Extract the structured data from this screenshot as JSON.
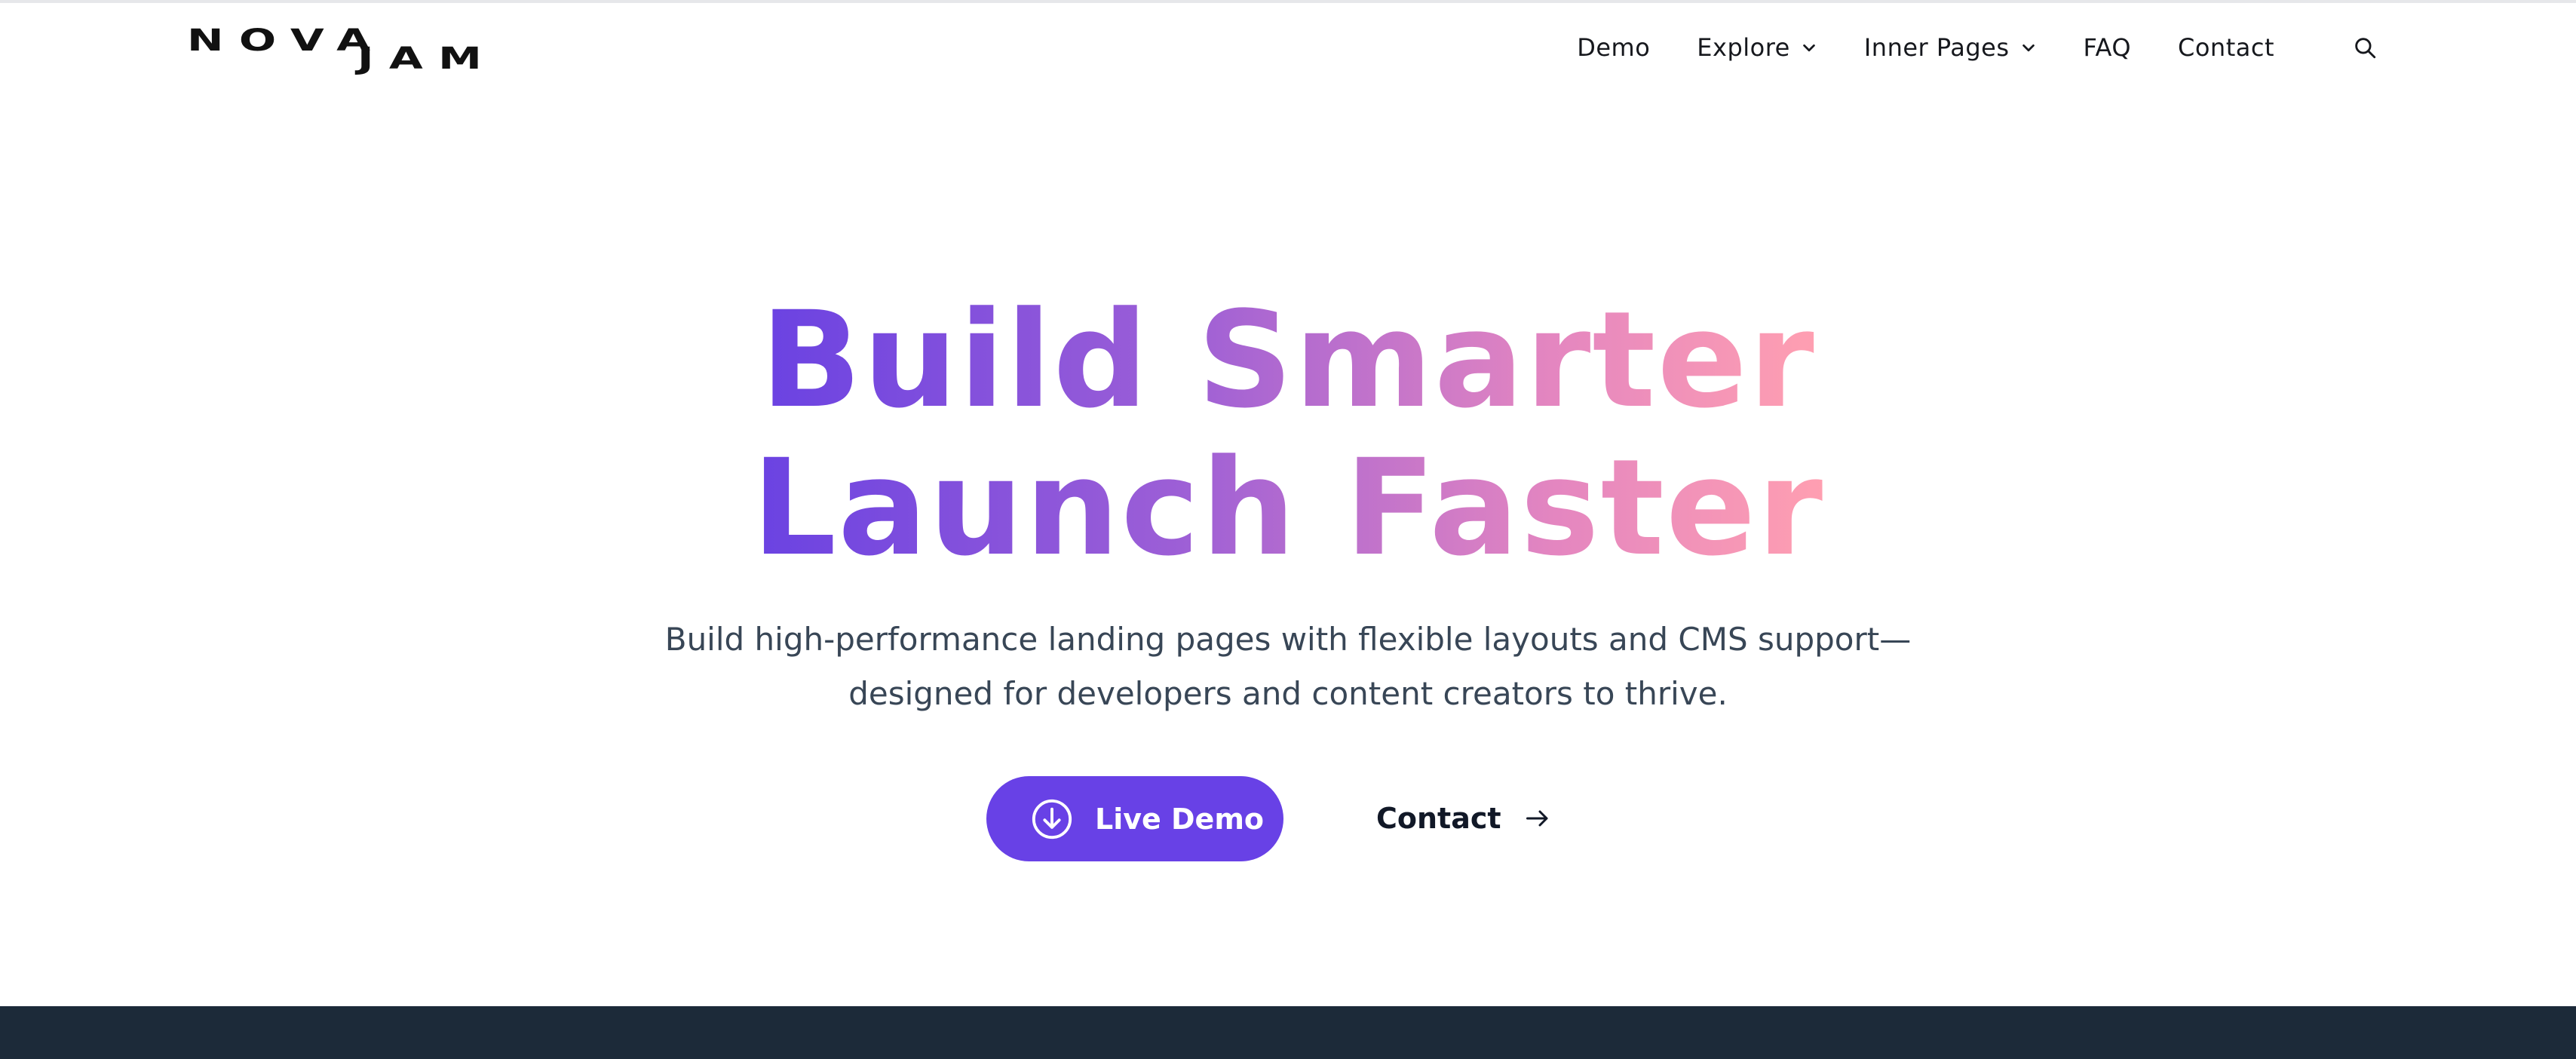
{
  "logo": {
    "line1": "NOVA",
    "line2": "JAM"
  },
  "nav": {
    "items": [
      {
        "label": "Demo",
        "dropdown": false
      },
      {
        "label": "Explore",
        "dropdown": true
      },
      {
        "label": "Inner Pages",
        "dropdown": true
      },
      {
        "label": "FAQ",
        "dropdown": false
      },
      {
        "label": "Contact",
        "dropdown": false
      }
    ],
    "search_icon": "search-icon"
  },
  "hero": {
    "title_line1": "Build Smarter",
    "title_line2": "Launch Faster",
    "subtitle_line1": "Build high-performance landing pages with flexible layouts and CMS support—",
    "subtitle_line2": "designed for developers and content creators to thrive.",
    "primary_cta": {
      "label": "Live Demo",
      "icon": "download-circle-icon"
    },
    "secondary_cta": {
      "label": "Contact",
      "icon": "arrow-right-icon"
    }
  },
  "colors": {
    "accent": "#6841e6",
    "gradient_start": "#6a42e2",
    "gradient_end": "#ff9fb1",
    "text_dark": "#111827",
    "subtitle": "#384656",
    "footer_band": "#1c2a39"
  }
}
